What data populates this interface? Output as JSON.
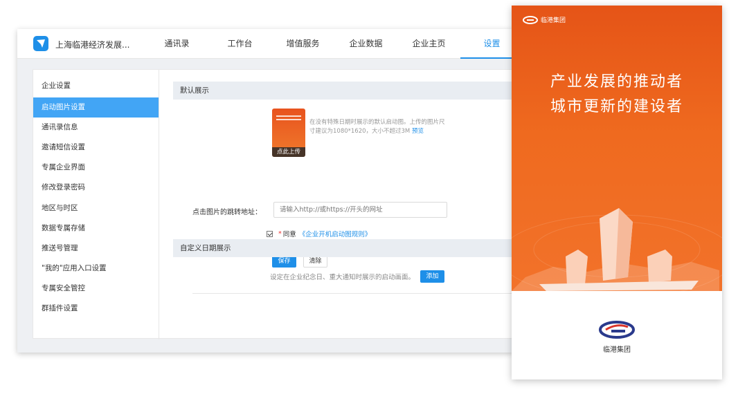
{
  "app": {
    "title": "上海临港经济发展..."
  },
  "nav": [
    {
      "label": "通讯录"
    },
    {
      "label": "工作台"
    },
    {
      "label": "增值服务"
    },
    {
      "label": "企业数据"
    },
    {
      "label": "企业主页"
    },
    {
      "label": "设置"
    }
  ],
  "nav_active": "设置",
  "sidebar": {
    "items": [
      {
        "label": "企业设置"
      },
      {
        "label": "启动图片设置"
      },
      {
        "label": "通讯录信息"
      },
      {
        "label": "邀请短信设置"
      },
      {
        "label": "专属企业界面"
      },
      {
        "label": "修改登录密码"
      },
      {
        "label": "地区与时区"
      },
      {
        "label": "数据专属存储"
      },
      {
        "label": "推送号管理"
      },
      {
        "label": "\"我的\"应用入口设置"
      },
      {
        "label": "专属安全管控"
      },
      {
        "label": "群插件设置"
      }
    ],
    "active": "启动图片设置"
  },
  "default_section": {
    "title": "默认展示",
    "upload_label": "点此上传",
    "hint_text": "在没有特殊日期时展示的默认启动图。上传的图片尺寸建议为1080*1620，大小不超过3M",
    "preview_link": "预览",
    "url_label": "点击图片的跳转地址：",
    "url_placeholder": "请输入http://或https://开头的网址",
    "url_value": "",
    "agree_checked": true,
    "agree_required_mark": "*",
    "agree_text": "同意",
    "agree_link": "《企业开机启动图规则》",
    "save_button": "保存",
    "clear_button": "清除"
  },
  "custom_section": {
    "title": "自定义日期展示",
    "description": "设定在企业纪念日、重大通知时展示的启动画面。",
    "add_button": "添加"
  },
  "preview": {
    "brand_name": "临港集团",
    "slogan_line1": "产业发展的推动者",
    "slogan_line2": "城市更新的建设者",
    "colors": {
      "background_top": "#e55417",
      "background_bottom": "#f2722a",
      "brand_blue": "#2a3a8c",
      "brand_red": "#d9342b"
    }
  },
  "colors": {
    "accent": "#1e8fe8",
    "sidebar_active": "#42a5f5"
  }
}
